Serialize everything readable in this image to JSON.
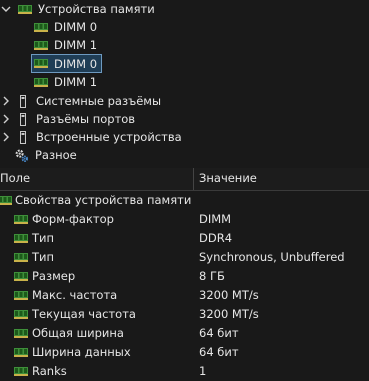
{
  "tree": {
    "memory_devices": "Устройства памяти",
    "dimms": [
      "DIMM 0",
      "DIMM 1",
      "DIMM 0",
      "DIMM 1"
    ],
    "system_slots": "Системные разъёмы",
    "port_connectors": "Разъёмы портов",
    "onboard_devices": "Встроенные устройства",
    "misc": "Разное"
  },
  "columns": {
    "field": "Поле",
    "value": "Значение"
  },
  "properties": {
    "group": "Свойства устройства памяти",
    "rows": [
      {
        "name": "Форм-фактор",
        "value": "DIMM"
      },
      {
        "name": "Тип",
        "value": "DDR4"
      },
      {
        "name": "Тип",
        "value": "Synchronous, Unbuffered"
      },
      {
        "name": "Размер",
        "value": "8 ГБ"
      },
      {
        "name": "Макс. частота",
        "value": "3200 MT/s"
      },
      {
        "name": "Текущая частота",
        "value": "3200 MT/s"
      },
      {
        "name": "Общая ширина",
        "value": "64 бит"
      },
      {
        "name": "Ширина данных",
        "value": "64 бит"
      },
      {
        "name": "Ranks",
        "value": "1"
      }
    ]
  },
  "colors": {
    "background": "#191919",
    "selection": "#1f3d55",
    "ram_icon": "#3f8f3a"
  }
}
